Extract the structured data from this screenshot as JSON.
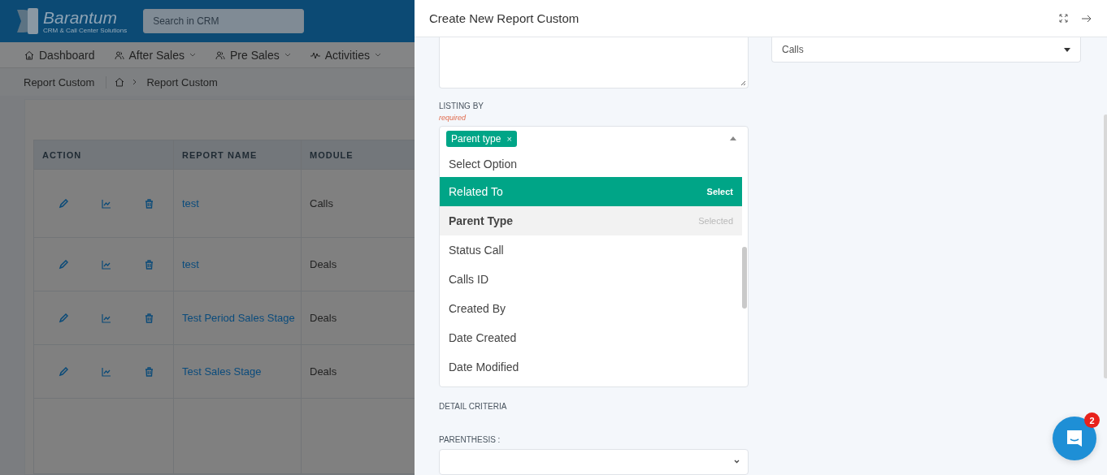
{
  "app": {
    "brand": "Barantum",
    "tagline": "CRM & Call Center Solutions",
    "search": {
      "placeholder": "Search in CRM"
    }
  },
  "nav": [
    {
      "label": "Dashboard",
      "kind": "home",
      "dropdown": false
    },
    {
      "label": "After Sales",
      "kind": "people",
      "dropdown": true
    },
    {
      "label": "Pre Sales",
      "kind": "people",
      "dropdown": true
    },
    {
      "label": "Activities",
      "kind": "activity",
      "dropdown": true
    }
  ],
  "breadcrumb": {
    "title": "Report Custom",
    "trail": "Report Custom"
  },
  "table": {
    "columns": [
      "ACTION",
      "REPORT NAME",
      "MODULE"
    ],
    "rows": [
      {
        "name": "test",
        "module": "Calls"
      },
      {
        "name": "test",
        "module": "Deals"
      },
      {
        "name": "Test Period Sales Stage",
        "module": "Deals"
      },
      {
        "name": "Test Sales Stage",
        "module": "Deals"
      }
    ]
  },
  "drawer": {
    "title": "Create New Report Custom",
    "module_select": {
      "value": "Calls"
    },
    "listing": {
      "label": "LISTING BY",
      "required": "required",
      "tags": [
        {
          "label": "Parent type",
          "remove": "×"
        }
      ],
      "expanded": true,
      "options": [
        {
          "kind": "placeholder",
          "label": "Select Option"
        },
        {
          "kind": "option",
          "label": "Related To",
          "hint": "Select",
          "selected": false,
          "highlighted": true
        },
        {
          "kind": "option",
          "label": "Parent Type",
          "hint": "Selected",
          "selected": true,
          "highlighted": false
        },
        {
          "kind": "option",
          "label": "Status Call",
          "selected": false,
          "highlighted": false
        },
        {
          "kind": "option",
          "label": "Calls ID",
          "selected": false,
          "highlighted": false
        },
        {
          "kind": "option",
          "label": "Created By",
          "selected": false,
          "highlighted": false
        },
        {
          "kind": "option",
          "label": "Date Created",
          "selected": false,
          "highlighted": false
        },
        {
          "kind": "option",
          "label": "Date Modified",
          "selected": false,
          "highlighted": false
        }
      ]
    },
    "detail_criteria": "DETAIL CRITERIA",
    "parenthesis": {
      "label": "PARENTHESIS :"
    }
  },
  "chat": {
    "badge": "2"
  }
}
